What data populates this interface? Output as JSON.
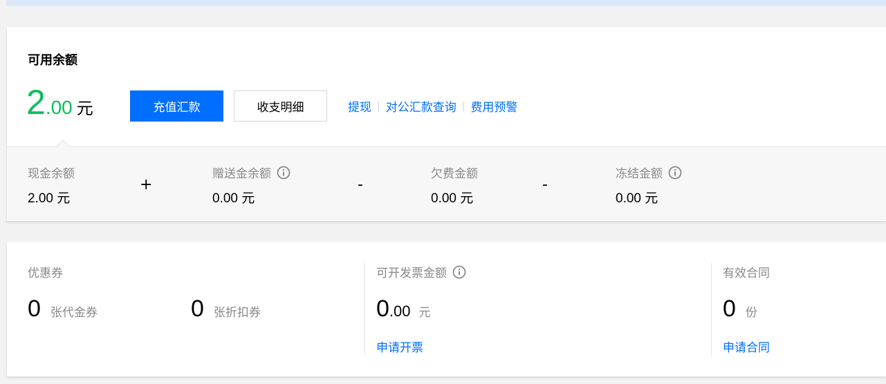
{
  "balance": {
    "title": "可用余额",
    "amount_int": "2",
    "amount_dec": ".00",
    "unit": "元",
    "recharge_button": "充值汇款",
    "details_button": "收支明细",
    "links": [
      "提现",
      "对公汇款查询",
      "费用预警"
    ],
    "breakdown": {
      "cash": {
        "label": "现金余额",
        "value": "2.00",
        "unit": "元"
      },
      "op_plus": "+",
      "gift": {
        "label": "赠送金余额",
        "value": "0.00",
        "unit": "元"
      },
      "op_minus1": "-",
      "arrears": {
        "label": "欠费金额",
        "value": "0.00",
        "unit": "元"
      },
      "op_minus2": "-",
      "frozen": {
        "label": "冻结金额",
        "value": "0.00",
        "unit": "元"
      }
    }
  },
  "coupons": {
    "label": "优惠券",
    "vouchers": {
      "count": "0",
      "unit": "张代金券"
    },
    "discounts": {
      "count": "0",
      "unit": "张折扣券"
    }
  },
  "invoice": {
    "label": "可开发票金额",
    "amount_int": "0",
    "amount_dec": ".00",
    "unit": "元",
    "link": "申请开票"
  },
  "contracts": {
    "label": "有效合同",
    "count": "0",
    "unit": "份",
    "link": "申请合同"
  },
  "colors": {
    "accent": "#006eff",
    "amount_green": "#0abf5b"
  }
}
